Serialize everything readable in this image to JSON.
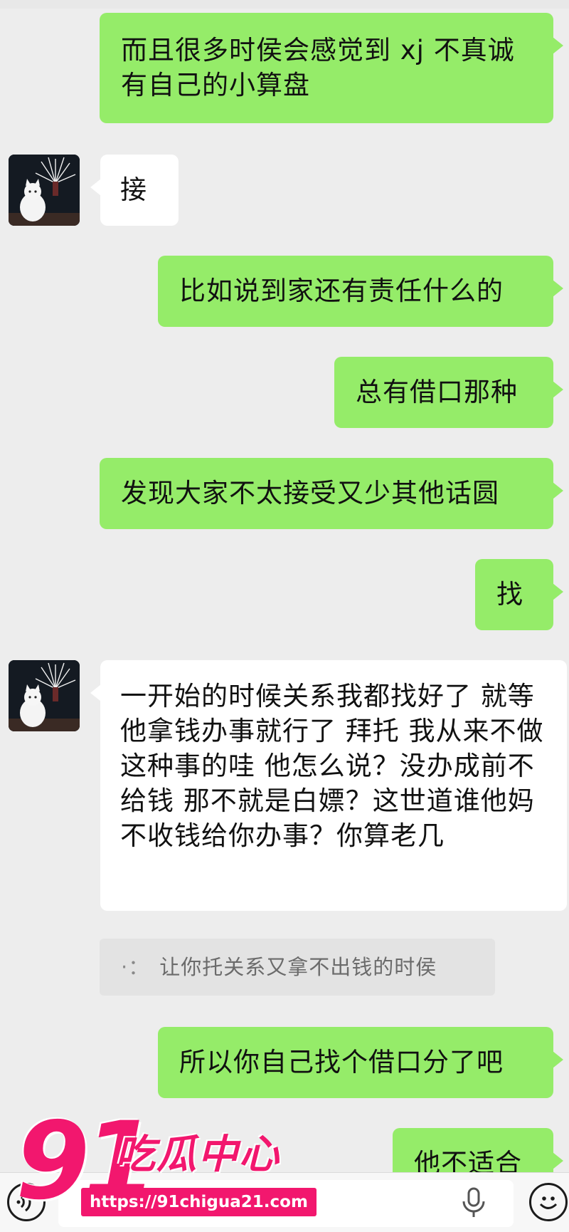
{
  "chat": {
    "messages": [
      {
        "side": "out",
        "text": "而且很多时侯会感觉到 xj 不真诚有自己的小算盘"
      },
      {
        "side": "in",
        "text": "接"
      },
      {
        "side": "out",
        "text": "比如说到家还有责任什么的"
      },
      {
        "side": "out",
        "text": "总有借口那种"
      },
      {
        "side": "out",
        "text": "发现大家不太接受又少其他话圆"
      },
      {
        "side": "out",
        "text": "找"
      },
      {
        "side": "in",
        "text": "一开始的时候关系我都找好了 就等他拿钱办事就行了 拜托 我从来不做这种事的哇 他怎么说？没办成前不给钱 那不就是白嫖？这世道谁他妈不收钱给你办事？你算老几"
      },
      {
        "side": "quote",
        "text": "让你托关系又拿不出钱的时侯",
        "marker": "·："
      },
      {
        "side": "out",
        "text": "所以你自己找个借口分了吧"
      },
      {
        "side": "out",
        "text": "他不适合"
      }
    ]
  },
  "input_bar": {
    "voice_icon": "voice-icon",
    "mic_icon": "microphone-icon",
    "emoji_icon": "emoji-icon"
  },
  "watermark": {
    "number": "91",
    "name": "吃瓜中心",
    "url": "https://91chigua21.com"
  },
  "colors": {
    "outgoing_bubble": "#95ec69",
    "incoming_bubble": "#ffffff",
    "background": "#ededed",
    "watermark": "#f2176e"
  }
}
